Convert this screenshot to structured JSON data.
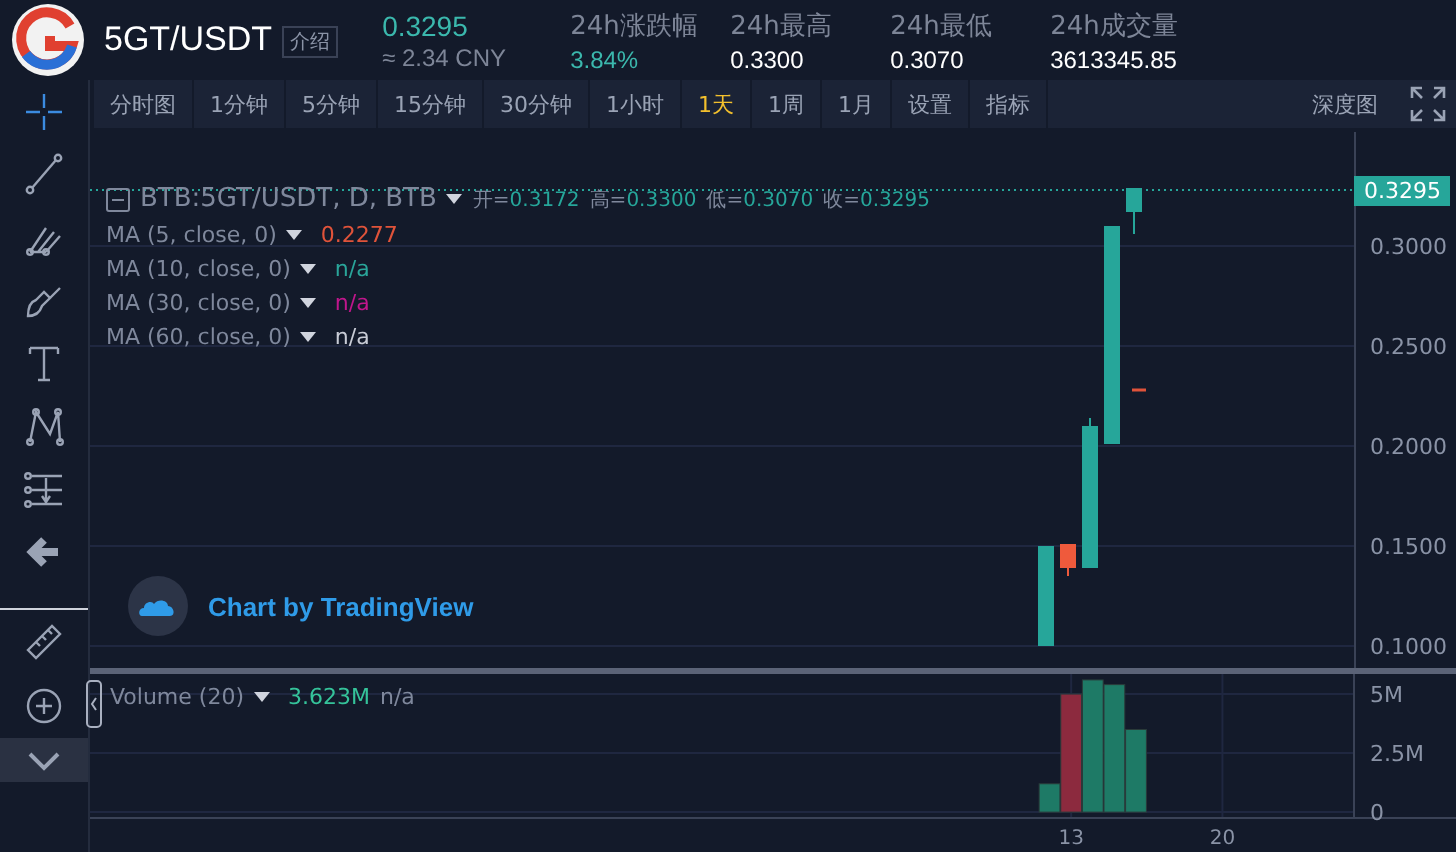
{
  "header": {
    "pair": "5GT/USDT",
    "intro_tag": "介绍",
    "last_price": "0.3295",
    "approx_price": "≈ 2.34 CNY",
    "stats": [
      {
        "label": "24h涨跌幅",
        "value": "3.84%",
        "kind": "change"
      },
      {
        "label": "24h最高",
        "value": "0.3300",
        "kind": "plain"
      },
      {
        "label": "24h最低",
        "value": "0.3070",
        "kind": "plain"
      },
      {
        "label": "24h成交量",
        "value": "3613345.85",
        "kind": "plain"
      }
    ]
  },
  "toolbar": [
    {
      "label": "分时图",
      "selected": false
    },
    {
      "label": "1分钟",
      "selected": false
    },
    {
      "label": "5分钟",
      "selected": false
    },
    {
      "label": "15分钟",
      "selected": false
    },
    {
      "label": "30分钟",
      "selected": false
    },
    {
      "label": "1小时",
      "selected": false
    },
    {
      "label": "1天",
      "selected": true
    },
    {
      "label": "1周",
      "selected": false
    },
    {
      "label": "1月",
      "selected": false
    },
    {
      "label": "设置",
      "selected": false
    },
    {
      "label": "指标",
      "selected": false
    }
  ],
  "depth_button": "深度图",
  "drawing_tools": [
    {
      "kind": "crosshair",
      "selected": true
    },
    {
      "kind": "line",
      "selected": false
    },
    {
      "kind": "pitchfork",
      "selected": false
    },
    {
      "kind": "brush",
      "selected": false
    },
    {
      "kind": "text",
      "selected": false
    },
    {
      "kind": "pattern",
      "selected": false
    },
    {
      "kind": "measure",
      "selected": false
    },
    {
      "kind": "arrow",
      "selected": false
    },
    {
      "kind": "ruler",
      "selected": false
    },
    {
      "kind": "zoom",
      "selected": false
    },
    {
      "kind": "chevron",
      "selected": false
    }
  ],
  "legend": {
    "symbol": "BTB:5GT/USDT, D, BTB",
    "ohlc": [
      {
        "label": "开=",
        "value": "0.3172"
      },
      {
        "label": "高=",
        "value": "0.3300"
      },
      {
        "label": "低=",
        "value": "0.3070"
      },
      {
        "label": "收=",
        "value": "0.3295"
      }
    ],
    "indicators": [
      {
        "name": "MA (5, close, 0)",
        "value": "0.2277",
        "color": "#e0533a"
      },
      {
        "name": "MA (10, close, 0)",
        "value": "n/a",
        "color": "#2aa59a"
      },
      {
        "name": "MA (30, close, 0)",
        "value": "n/a",
        "color": "#c0168c"
      },
      {
        "name": "MA (60, close, 0)",
        "value": "n/a",
        "color": "#c8ccd6"
      }
    ]
  },
  "branding": "Chart by TradingView",
  "price_axis": {
    "last_price_label": "0.3295",
    "ticks": [
      "0.3000",
      "0.2500",
      "0.2000",
      "0.1500",
      "0.1000"
    ]
  },
  "volume": {
    "legend": "Volume (20)",
    "value": "3.623M",
    "value_2": "n/a",
    "chart_data": {
      "type": "bar",
      "x": [
        12,
        13,
        14,
        15,
        16
      ],
      "xlim": [
        -32.4,
        30.9
      ],
      "ylim": [
        -0.25,
        5.85
      ],
      "grid": true,
      "series": [
        {
          "color": "#1e7a66",
          "values": [
            1.2,
            null,
            5.6,
            5.4,
            3.5
          ]
        },
        {
          "color": "#8c2a3e",
          "values": [
            null,
            5.0,
            null,
            null,
            null
          ]
        }
      ],
      "yticks": [
        {
          "value": 0,
          "label": "0"
        },
        {
          "value": 2.5,
          "label": "2.5M"
        },
        {
          "value": 5,
          "label": "5M"
        }
      ],
      "xticks": [
        {
          "value": 13,
          "label": "13"
        },
        {
          "value": 20,
          "label": "20"
        }
      ]
    }
  }
}
